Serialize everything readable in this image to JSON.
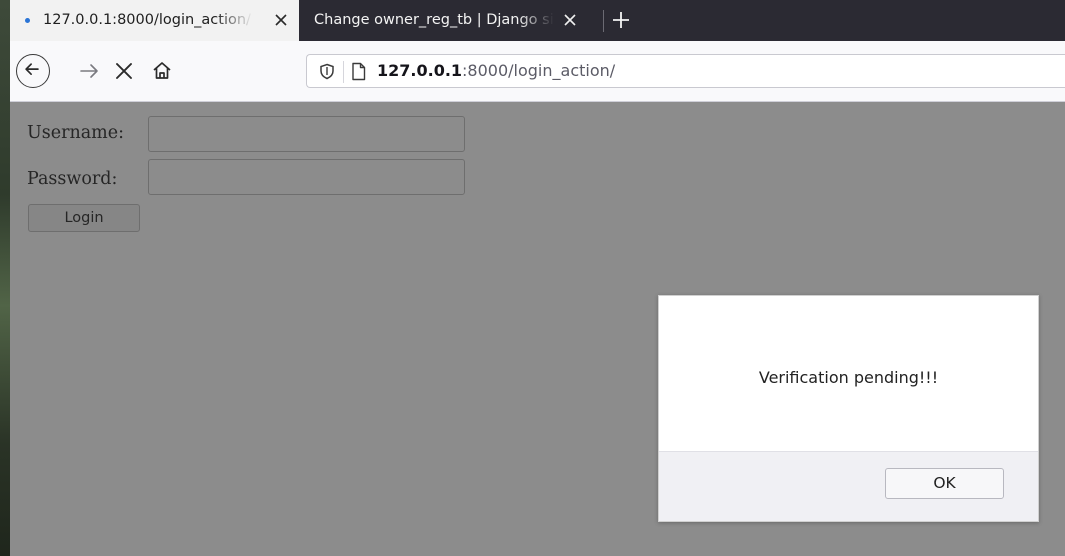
{
  "browser": {
    "tabs": [
      {
        "title": "127.0.0.1:8000/login_action/",
        "active": true
      },
      {
        "title": "Change owner_reg_tb | Django site admin",
        "active": false
      }
    ],
    "url": {
      "host": "127.0.0.1",
      "rest": ":8000/login_action/"
    }
  },
  "form": {
    "username_label": "Username:",
    "password_label": "Password:",
    "username_value": "",
    "password_value": "",
    "login_label": "Login"
  },
  "dialog": {
    "message": "Verification pending!!!",
    "ok_label": "OK"
  },
  "colors": {
    "page_dim": "#8c8c8c",
    "tabbar": "#2b2a33",
    "loading_dot": "#2a74d6"
  },
  "icons": [
    "back-arrow-icon",
    "forward-arrow-icon",
    "stop-icon",
    "home-icon",
    "shield-icon",
    "page-icon",
    "close-icon",
    "plus-icon"
  ]
}
